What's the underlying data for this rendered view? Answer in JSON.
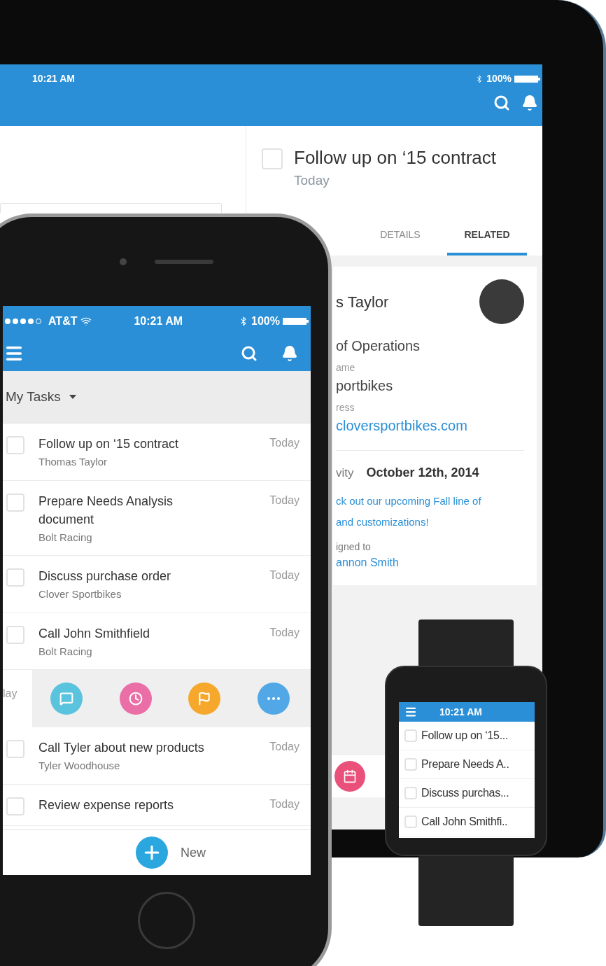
{
  "tablet": {
    "status": {
      "time": "10:21 AM",
      "battery": "100%"
    },
    "detail": {
      "checked": false,
      "title": "Follow up on ‘15 contract",
      "due": "Today",
      "tabs": [
        {
          "label": "DETAILS",
          "selected": false
        },
        {
          "label": "RELATED",
          "selected": true
        }
      ],
      "contact": {
        "name": "s Taylor",
        "role": "of Operations",
        "fields": [
          {
            "label": "ame",
            "value": "portbikes",
            "kind": "text"
          },
          {
            "label": "ress",
            "value": "cloversportbikes.com",
            "kind": "link"
          }
        ]
      },
      "activity": {
        "label": "vity",
        "date": "October 12th, 2014",
        "message_lines": [
          "ck out our upcoming Fall line of",
          "and customizations!"
        ],
        "assigned_label": "igned to",
        "assignee": "annon Smith"
      }
    }
  },
  "phone": {
    "status": {
      "carrier": "AT&T",
      "time": "10:21 AM",
      "battery": "100%"
    },
    "list_title": "My Tasks",
    "tasks": [
      {
        "kind": "task",
        "title": "Follow up on ‘15 contract",
        "subtitle": "Thomas Taylor",
        "due": "Today",
        "checked": false
      },
      {
        "kind": "task",
        "title": "Prepare Needs Analysis document",
        "subtitle": "Bolt Racing",
        "due": "Today",
        "checked": false
      },
      {
        "kind": "task",
        "title": "Discuss purchase order",
        "subtitle": "Clover Sportbikes",
        "due": "Today",
        "checked": false
      },
      {
        "kind": "task",
        "title": "Call John Smithfield",
        "subtitle": "Bolt Racing",
        "due": "Today",
        "checked": false
      },
      {
        "kind": "actions",
        "due": "lay",
        "actions": [
          {
            "kind": "comment",
            "color": "#5ac3de"
          },
          {
            "kind": "clock",
            "color": "#ea6fa6"
          },
          {
            "kind": "flag",
            "color": "#f6a82c"
          },
          {
            "kind": "more",
            "color": "#52a8e6"
          }
        ]
      },
      {
        "kind": "task",
        "title": "Call Tyler about new products",
        "subtitle": "Tyler Woodhouse",
        "due": "Today",
        "checked": false
      },
      {
        "kind": "task",
        "title": "Review expense reports",
        "due": "Today",
        "checked": false
      }
    ],
    "new_label": "New"
  },
  "watch": {
    "time": "10:21 AM",
    "tasks": [
      {
        "title": "Follow up on ‘15...",
        "checked": false
      },
      {
        "title": "Prepare Needs A..",
        "checked": false
      },
      {
        "title": "Discuss purchas...",
        "checked": false
      },
      {
        "title": "Call John Smithfi..",
        "checked": false
      }
    ]
  }
}
